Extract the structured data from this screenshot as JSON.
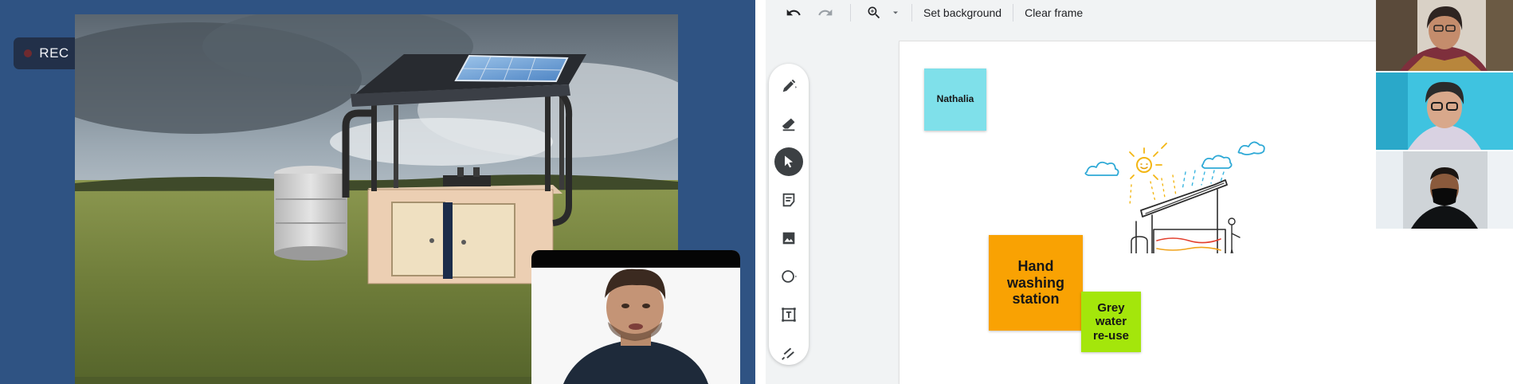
{
  "meeting": {
    "recording_label": "REC",
    "recording_dot_color": "#6f2a2f"
  },
  "whiteboard": {
    "toolbar": {
      "undo_icon": "undo-icon",
      "redo_icon": "redo-icon",
      "zoom_icon": "zoom-in-icon",
      "set_background_label": "Set background",
      "clear_frame_label": "Clear frame"
    },
    "tools": [
      {
        "name": "pen",
        "icon": "pen-icon"
      },
      {
        "name": "eraser",
        "icon": "eraser-icon"
      },
      {
        "name": "select",
        "icon": "cursor-icon",
        "active": true
      },
      {
        "name": "sticky-note",
        "icon": "sticky-note-icon"
      },
      {
        "name": "image",
        "icon": "image-icon"
      },
      {
        "name": "shape",
        "icon": "circle-shape-icon"
      },
      {
        "name": "text-box",
        "icon": "text-box-icon"
      },
      {
        "name": "laser",
        "icon": "laser-pointer-icon"
      }
    ],
    "stickies": [
      {
        "lines": [
          "Nathalia"
        ],
        "color": "#7fe0ea"
      },
      {
        "lines": [
          "Hand",
          "washing",
          "station"
        ],
        "color": "#f9a203"
      },
      {
        "lines": [
          "Grey",
          "water",
          "re-use"
        ],
        "color": "#a4e60b"
      }
    ]
  }
}
